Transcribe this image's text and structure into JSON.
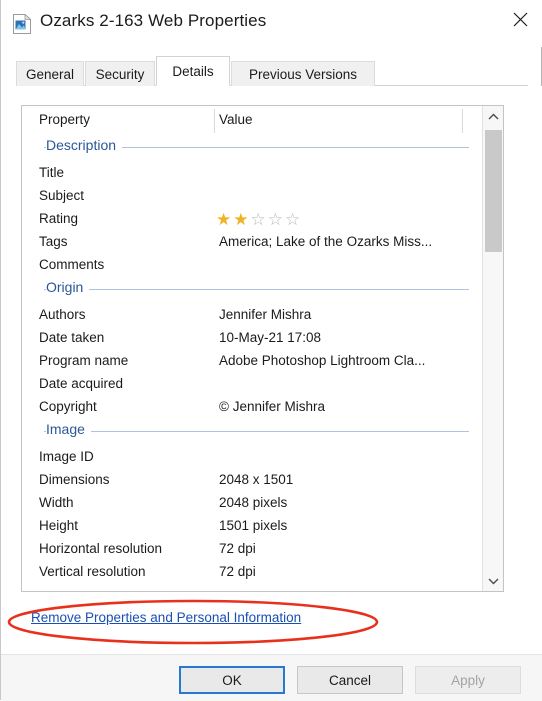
{
  "window": {
    "title": "Ozarks 2-163 Web Properties",
    "icon": "image-file-icon",
    "close_label": "✕"
  },
  "tabs": [
    {
      "label": "General",
      "active": false
    },
    {
      "label": "Security",
      "active": false
    },
    {
      "label": "Details",
      "active": true
    },
    {
      "label": "Previous Versions",
      "active": false
    }
  ],
  "list": {
    "header_property": "Property",
    "header_value": "Value",
    "sections": [
      {
        "title": "Description",
        "rows": [
          {
            "name": "Title",
            "value": ""
          },
          {
            "name": "Subject",
            "value": ""
          },
          {
            "name": "Rating",
            "value": "",
            "rating": 2,
            "rating_max": 5
          },
          {
            "name": "Tags",
            "value": "America; Lake of the Ozarks Miss..."
          },
          {
            "name": "Comments",
            "value": ""
          }
        ]
      },
      {
        "title": "Origin",
        "rows": [
          {
            "name": "Authors",
            "value": "Jennifer Mishra"
          },
          {
            "name": "Date taken",
            "value": "10-May-21 17:08"
          },
          {
            "name": "Program name",
            "value": "Adobe Photoshop Lightroom Cla..."
          },
          {
            "name": "Date acquired",
            "value": ""
          },
          {
            "name": "Copyright",
            "value": "© Jennifer Mishra"
          }
        ]
      },
      {
        "title": "Image",
        "rows": [
          {
            "name": "Image ID",
            "value": ""
          },
          {
            "name": "Dimensions",
            "value": "2048 x 1501"
          },
          {
            "name": "Width",
            "value": "2048 pixels"
          },
          {
            "name": "Height",
            "value": "1501 pixels"
          },
          {
            "name": "Horizontal resolution",
            "value": "72 dpi"
          },
          {
            "name": "Vertical resolution",
            "value": "72 dpi"
          }
        ]
      }
    ]
  },
  "scrollbar": {
    "up_icon": "chevron-up-icon",
    "down_icon": "chevron-down-icon"
  },
  "remove_link": {
    "label": "Remove Properties and Personal Information"
  },
  "annotation": {
    "shape": "ellipse",
    "color": "#e8301c"
  },
  "buttons": {
    "ok": "OK",
    "cancel": "Cancel",
    "apply": "Apply"
  },
  "colors": {
    "section_heading": "#2b5797",
    "link": "#1a4fb4",
    "star_filled": "#f0b323",
    "star_empty": "#b9b9b9",
    "focus_border": "#2878d0",
    "annotation": "#e8301c"
  }
}
